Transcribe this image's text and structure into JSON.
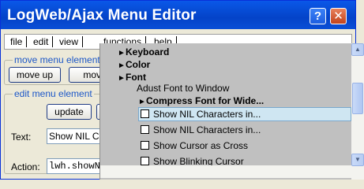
{
  "window": {
    "title": "LogWeb/Ajax Menu Editor",
    "help_label": "?",
    "close_label": "✕"
  },
  "menubar": {
    "items": [
      "file",
      "edit",
      "view",
      "functions",
      "help"
    ]
  },
  "move_group": {
    "legend": "move menu element",
    "move_up_label": "move up",
    "move_down_label": "move"
  },
  "edit_group": {
    "legend": "edit menu element",
    "update_label": "update",
    "text_label": "Text:",
    "text_value": "Show NIL C",
    "action_label": "Action:",
    "action_value": "lwh.showNI"
  },
  "functions_menu": {
    "items": [
      {
        "label": "Keyboard",
        "submenu_arrow": "►"
      },
      {
        "label": "Color",
        "submenu_arrow": "►"
      },
      {
        "label": "Font",
        "submenu_arrow": "►"
      },
      {
        "label": "Adust Font to Window"
      },
      {
        "label": "Compress Font for Wide...",
        "submenu_arrow": "►"
      },
      {
        "label": "Show NIL Characters in...",
        "checked": false,
        "highlighted": true
      },
      {
        "label": "Show NIL Characters in...",
        "checked": false
      },
      {
        "label": "Show Cursor as Cross",
        "checked": false
      },
      {
        "label": "Show Blinking Cursor",
        "checked": false
      }
    ]
  },
  "scroll": {
    "up_arrow": "▲",
    "down_arrow": "▼"
  },
  "colors": {
    "title_bar": "#0a58e8",
    "menu_background": "#c0c0c0",
    "highlight": "#cfe6f2",
    "legend_text": "#1c57c8"
  }
}
